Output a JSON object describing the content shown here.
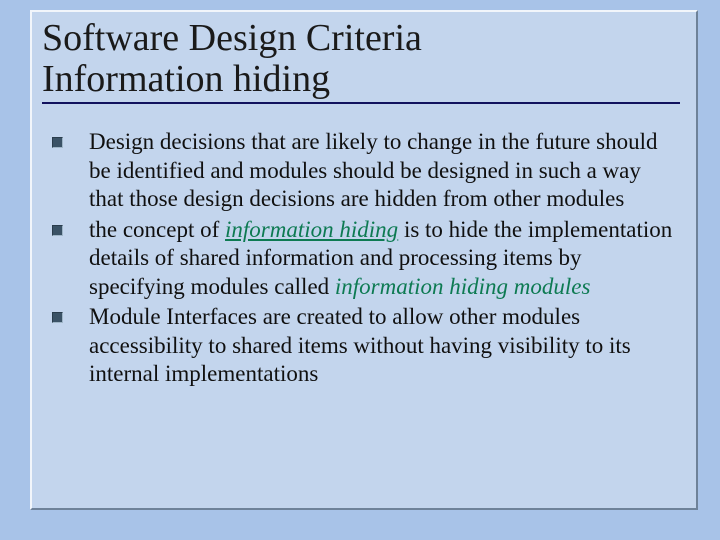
{
  "title": {
    "line1": "Software Design Criteria",
    "line2": " Information hiding"
  },
  "bullets": [
    {
      "pre": "Design decisions that are likely to change in the future should be identified and modules should be designed in such a way that those design decisions are hidden from other modules",
      "term1": "",
      "mid": "",
      "term2": "",
      "post": ""
    },
    {
      "pre": "the concept of ",
      "term1": "information hiding",
      "mid": " is to hide the implementation details of shared information and processing items by specifying modules called ",
      "term2": "information hiding modules",
      "post": ""
    },
    {
      "pre": "Module Interfaces are created to allow other modules accessibility to shared items without having visibility to its internal implementations",
      "term1": "",
      "mid": "",
      "term2": "",
      "post": ""
    }
  ],
  "colors": {
    "slide_bg": "#a8c3e8",
    "panel_bg": "#c3d5ed",
    "rule": "#11125e",
    "emphasis": "#0d7a52"
  }
}
